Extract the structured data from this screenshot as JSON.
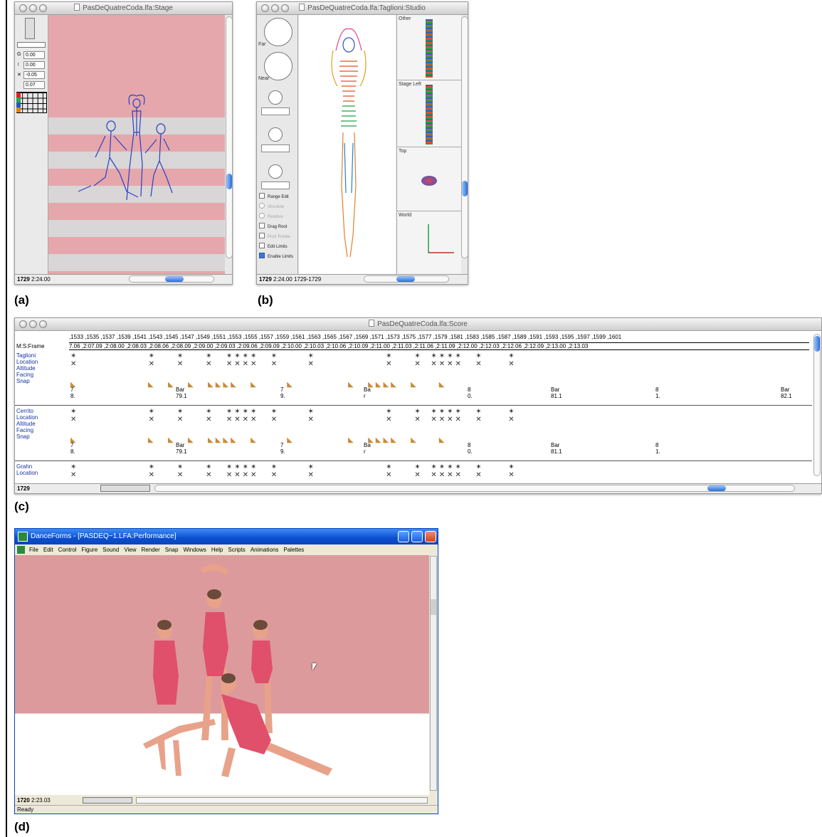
{
  "captions": {
    "a": "(a)",
    "b": "(b)",
    "c": "(c)",
    "d": "(d)"
  },
  "stage": {
    "title": "PasDeQuatreCoda.lfa:Stage",
    "fields": [
      "0.00",
      "0.00",
      "-0.05",
      "0.07"
    ],
    "status_frame": "1729",
    "status_time": "2:24.00"
  },
  "studio": {
    "title": "PasDeQuatreCoda.lfa:Taglioni:Studio",
    "far_label": "Far",
    "near_label": "Near",
    "options": [
      "Range Edit",
      "Absolute",
      "Relative",
      "Drag Root",
      "Root Rotate",
      "Edit Limits",
      "Enable Limits"
    ],
    "views": [
      "Other",
      "Stage Left",
      "Top",
      "World"
    ],
    "status_frame": "1729",
    "status_time": "2:24.00 1729-1729"
  },
  "score": {
    "title": "PasDeQuatreCoda.lfa:Score",
    "frames_row": ",1533 ,1535 ,1537 ,1539 ,1541 ,1543 ,1545 ,1547 ,1549 ,1551 ,1553 ,1555 ,1557 ,1559 ,1561 ,1563 ,1565 ,1567 ,1569 ,1571 ,1573 ,1575 ,1577 ,1579 ,1581 ,1583 ,1585 ,1587 ,1589 ,1591 ,1593 ,1595 ,1597 ,1599 ,1601",
    "mframe_label": "M:S:Frame",
    "times_row": "7.06 ,2:07.09 ,2:08.00 ,2:08.03 ,2:08.06 ,2:08.09 ,2:09.00 ,2:09.03 ,2:09.06 ,2:09.09 ,2:10.00 ,2:10.03 ,2:10.06 ,2:10.09 ,2:11.00 ,2:11.03 ,2:11.06 ,2:11.09 ,2:12.00 ,2:12.03 ,2:12.06 ,2:12.09 ,2:13.00 ,2:13.03",
    "dancers": [
      {
        "name": "Taglioni",
        "tracks": [
          "Location",
          "Altitude",
          "Facing",
          "Snap"
        ],
        "bars": [
          "7",
          "8.",
          "Bar",
          "79.1",
          "7",
          "9.",
          "Ba",
          "r",
          "8",
          "0.",
          "Bar",
          "81.1",
          "8",
          "1.",
          "Bar",
          "82.1"
        ]
      },
      {
        "name": "Cerrito",
        "tracks": [
          "Location",
          "Altitude",
          "Facing",
          "Snap"
        ],
        "bars": [
          "7",
          "8.",
          "Bar",
          "79.1",
          "7",
          "9.",
          "Ba",
          "r",
          "8",
          "0.",
          "Bar",
          "81.1",
          "8",
          "1."
        ]
      },
      {
        "name": "Grahn",
        "tracks": [
          "Location"
        ]
      }
    ],
    "status_frame": "1729"
  },
  "performance": {
    "title": "DanceForms - [PASDEQ~1.LFA:Performance]",
    "menu": [
      "File",
      "Edit",
      "Control",
      "Figure",
      "Sound",
      "View",
      "Render",
      "Snap",
      "Windows",
      "Help",
      "Scripts",
      "Animations",
      "Palettes"
    ],
    "status_frame": "1720",
    "status_time": "2:23.03",
    "status_ready": "Ready"
  }
}
